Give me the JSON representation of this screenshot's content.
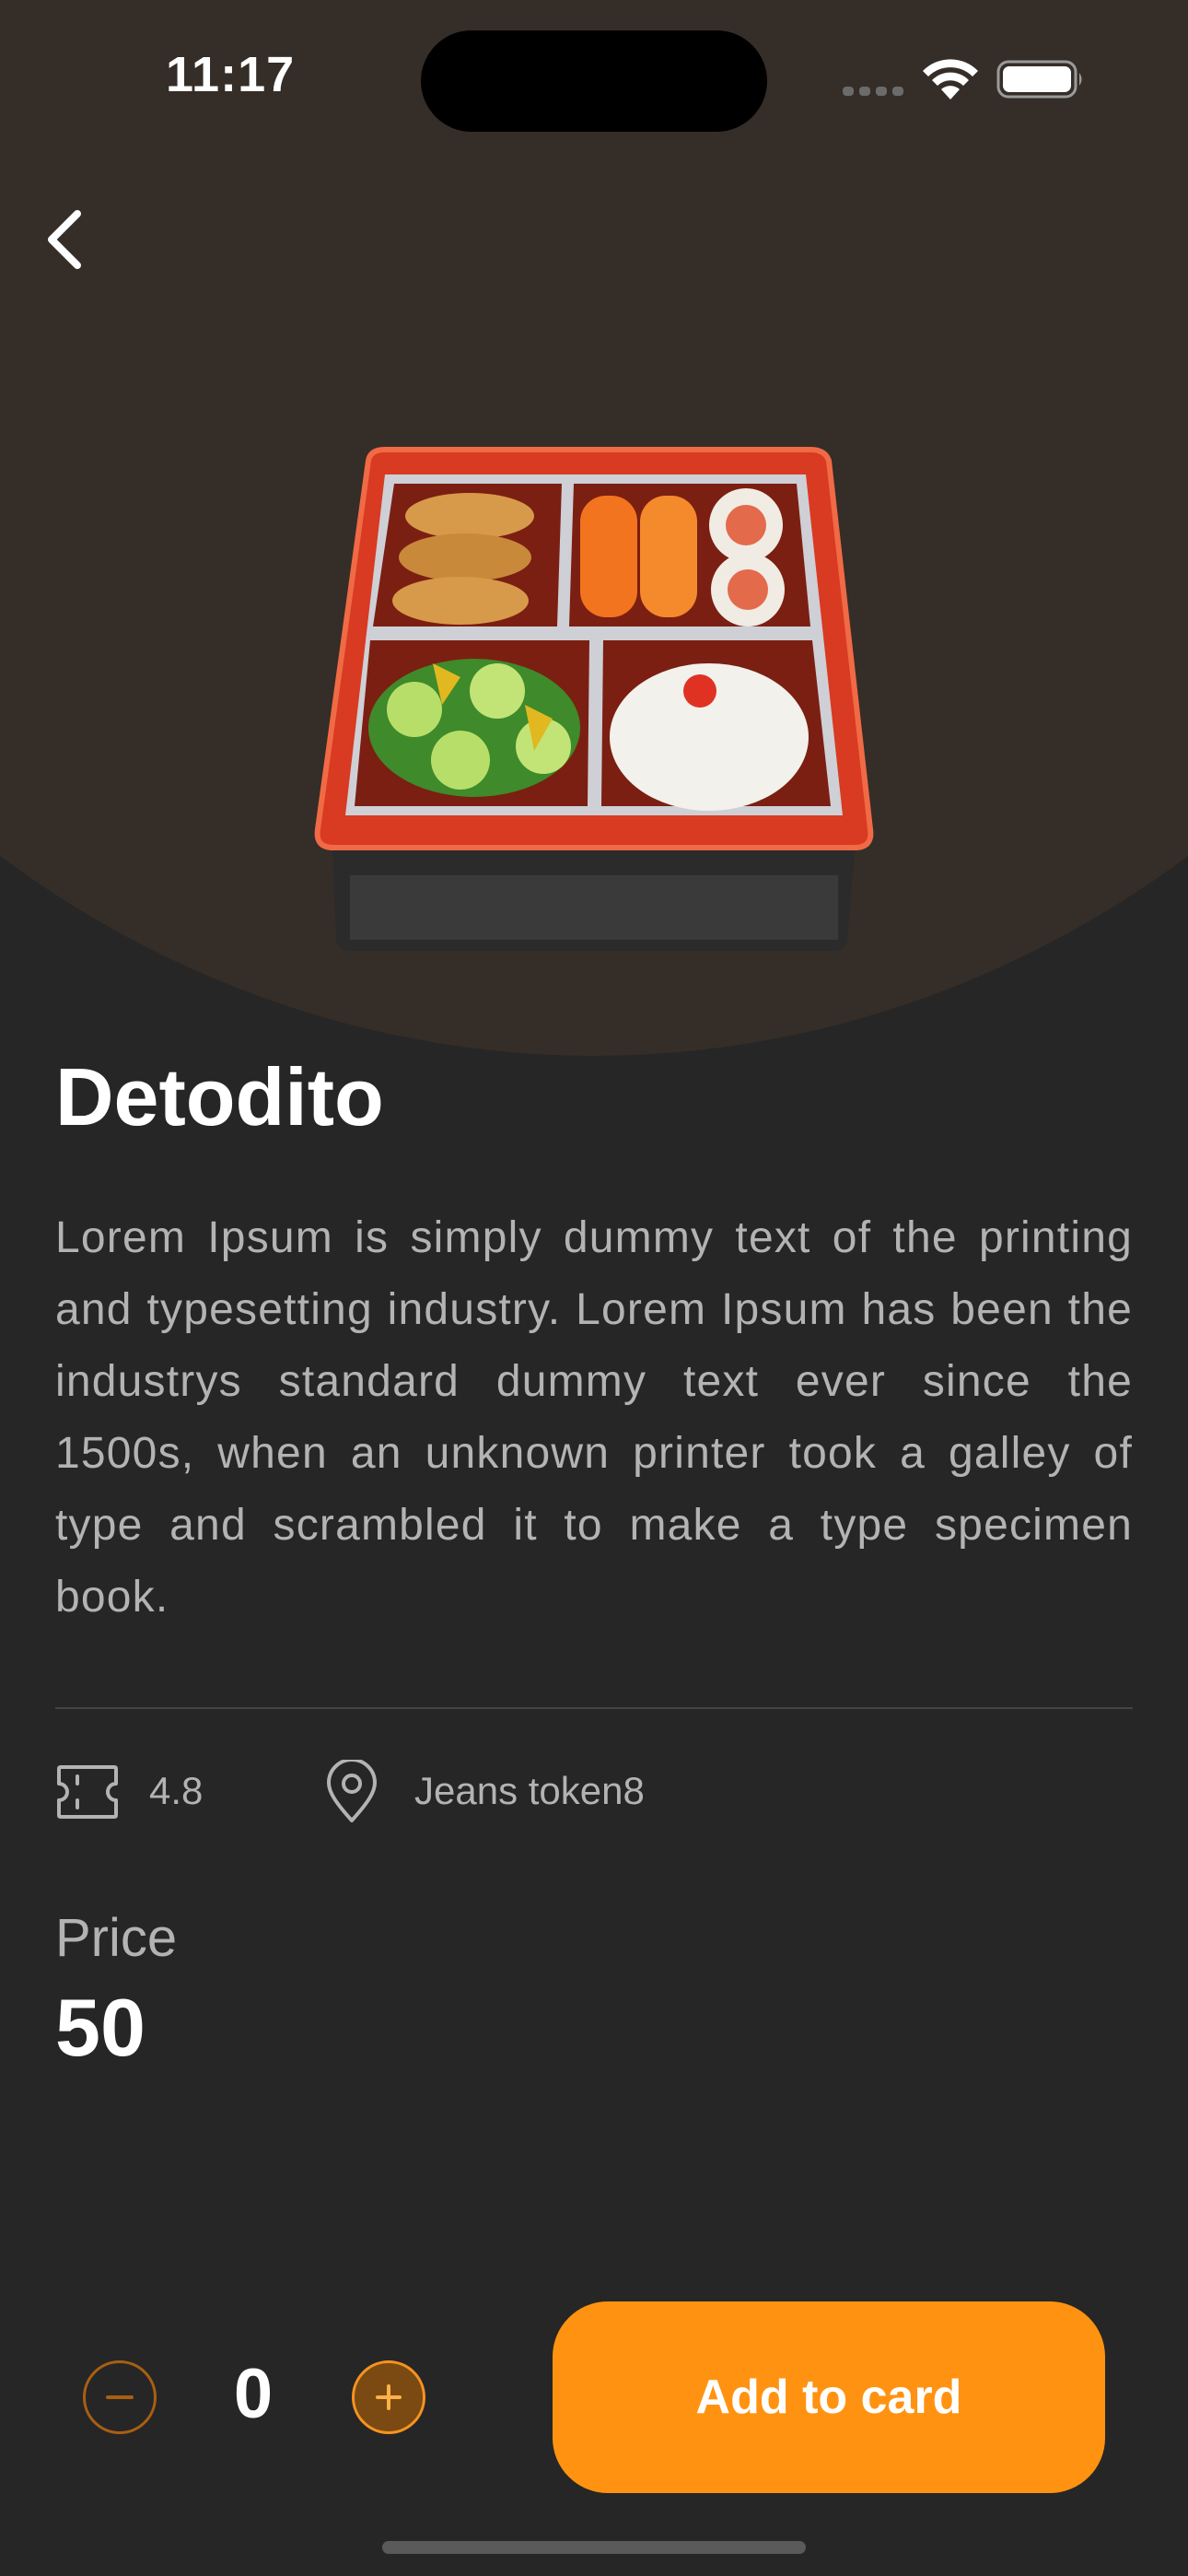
{
  "status_bar": {
    "time": "11:17",
    "icons": [
      "signal-icon",
      "wifi-icon",
      "battery-icon"
    ]
  },
  "navigation": {
    "back_icon": "chevron-left-icon"
  },
  "product": {
    "image_icon": "bento-box-icon",
    "title": "Detodito",
    "description": "Lorem Ipsum is simply dummy text of the printing and typesetting industry. Lorem Ipsum has been the industrys standard dummy text ever since the 1500s, when an unknown printer took a galley of type and scrambled it to make a type specimen book.",
    "rating": "4.8",
    "rating_icon": "ticket-icon",
    "location": "Jeans token8",
    "location_icon": "location-pin-icon",
    "price_label": "Price",
    "price": "50"
  },
  "cart": {
    "quantity": "0",
    "minus_symbol": "−",
    "plus_symbol": "+",
    "add_label": "Add to card"
  },
  "colors": {
    "background": "#262626",
    "hero": "#352d27",
    "accent": "#ff9311",
    "muted_text": "#b3b3b3"
  }
}
